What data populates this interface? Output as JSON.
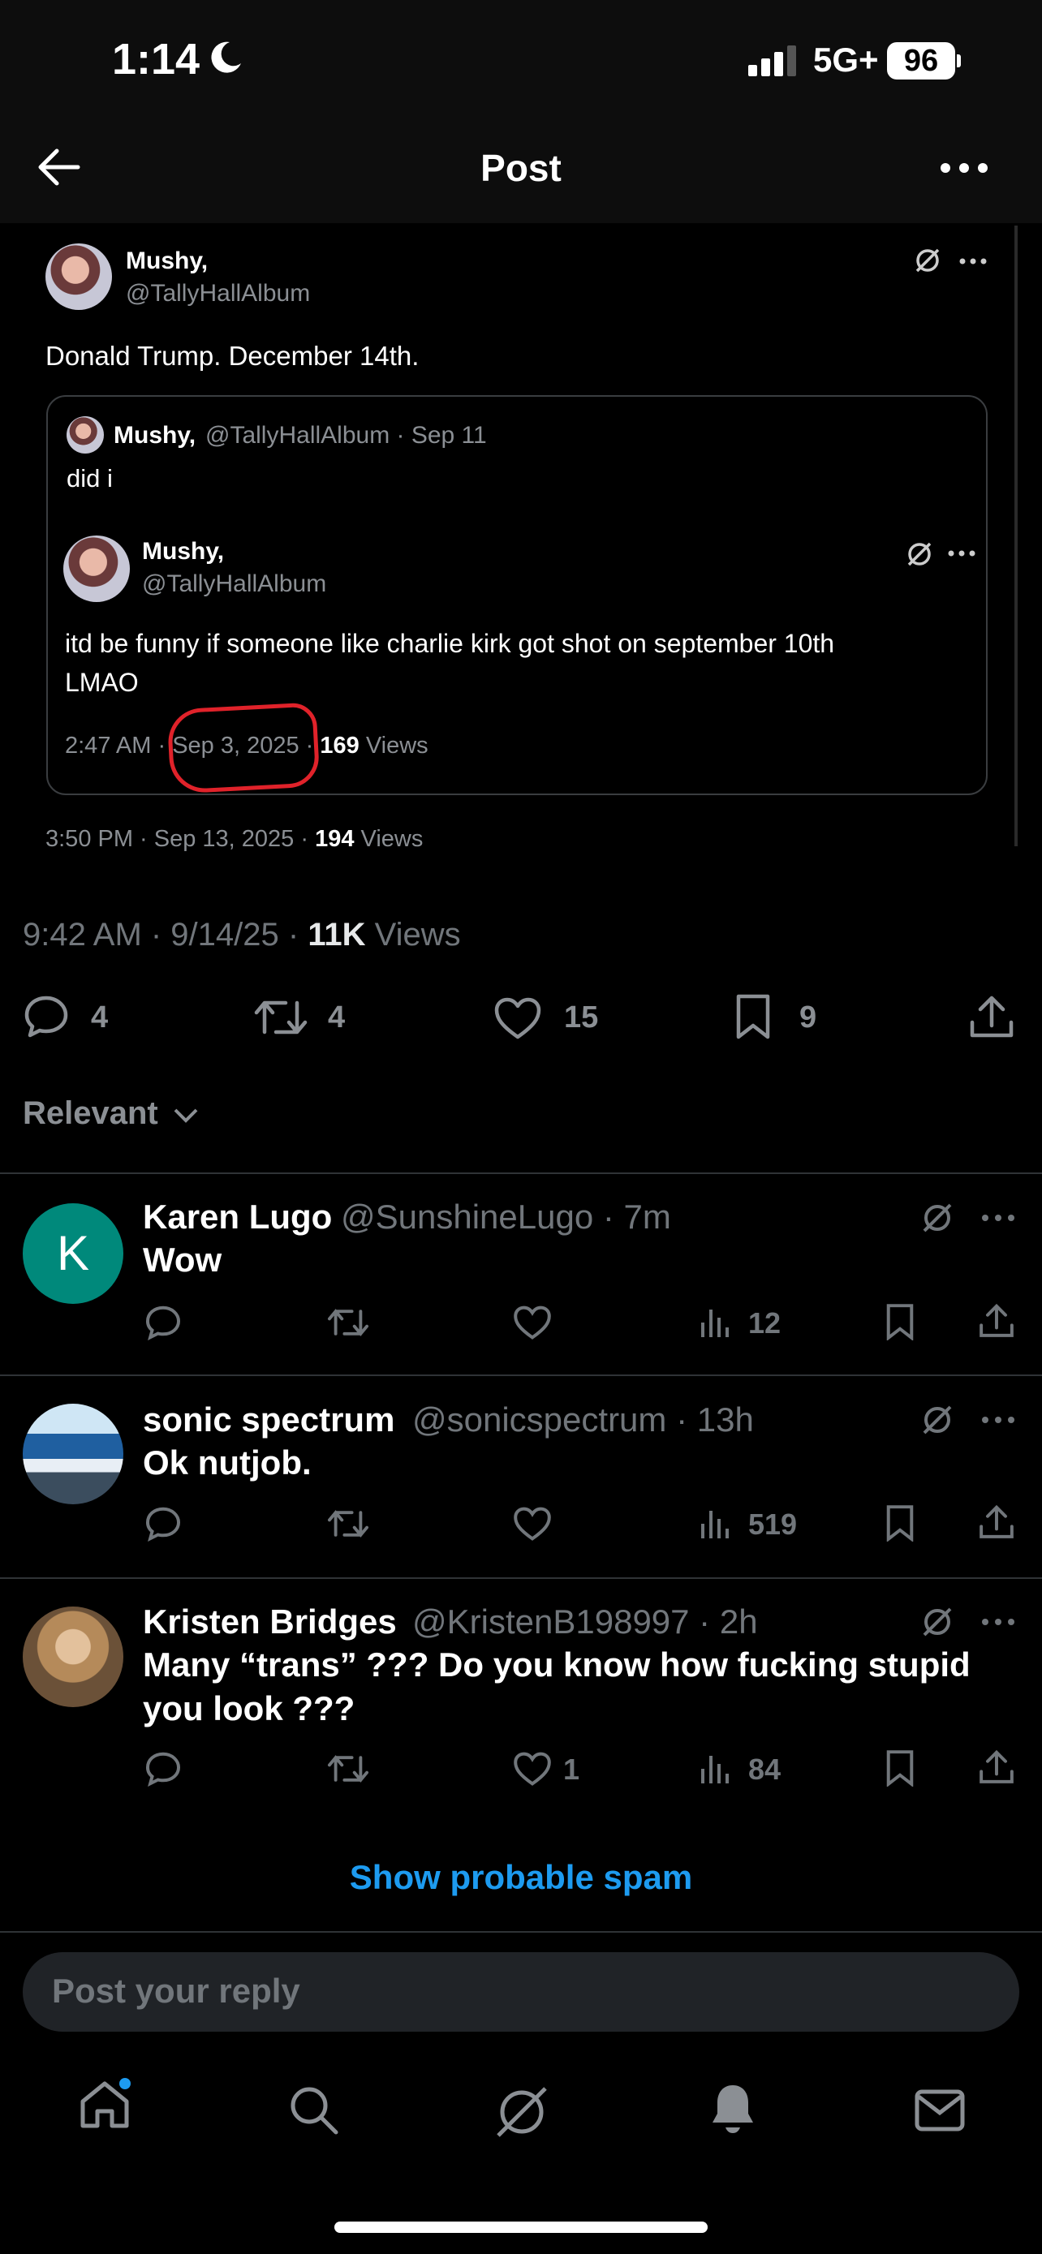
{
  "status_bar": {
    "time": "1:14",
    "network": "5G+",
    "battery": "96"
  },
  "header": {
    "title": "Post"
  },
  "embedded_post": {
    "author_name": "Mushy,",
    "author_handle": "@TallyHallAlbum",
    "text": "Donald Trump. December 14th.",
    "quoted": {
      "author_name": "Mushy,",
      "author_handle": "@TallyHallAlbum · Sep 11",
      "text": "did i",
      "inner": {
        "author_name": "Mushy,",
        "author_handle": "@TallyHallAlbum",
        "text_line1": "itd be funny if someone like charlie kirk got shot on september 10th",
        "text_line2": "LMAO",
        "time_prefix": "2:47 AM ·",
        "date": "Sep 3, 2025",
        "views_count": "169",
        "views_label": "Views"
      }
    },
    "time_prefix": "3:50 PM · Sep 13, 2025 ·",
    "views_count": "194",
    "views_label": "Views"
  },
  "post_meta": {
    "time": "9:42 AM · 9/14/25 ·",
    "views_count": "11K",
    "views_label": "Views"
  },
  "actions": {
    "replies": "4",
    "reposts": "4",
    "likes": "15",
    "bookmarks": "9"
  },
  "sort": {
    "label": "Relevant"
  },
  "replies": [
    {
      "avatar_letter": "K",
      "name": "Karen Lugo",
      "handle": "@SunshineLugo · 7m",
      "text": "Wow",
      "likes": "",
      "views": "12"
    },
    {
      "name": "sonic spectrum",
      "handle": "@sonicspectrum · 13h",
      "text": "Ok nutjob.",
      "likes": "",
      "views": "519"
    },
    {
      "name": "Kristen Bridges",
      "handle": "@KristenB198997 · 2h",
      "text_line1": "Many “trans” ??? Do you know how fucking stupid",
      "text_line2": "you look ???",
      "likes": "1",
      "views": "84"
    }
  ],
  "spam_link": "Show probable spam",
  "reply_placeholder": "Post your reply",
  "colors": {
    "accent": "#1d9bf0",
    "avatar_k": "#00897b",
    "annotation": "#e0222a"
  },
  "icons": [
    "back-arrow-icon",
    "more-icon",
    "grok-icon",
    "reply-icon",
    "repost-icon",
    "like-icon",
    "bookmark-icon",
    "share-icon",
    "views-icon",
    "home-icon",
    "search-icon",
    "notifications-icon",
    "messages-icon"
  ]
}
